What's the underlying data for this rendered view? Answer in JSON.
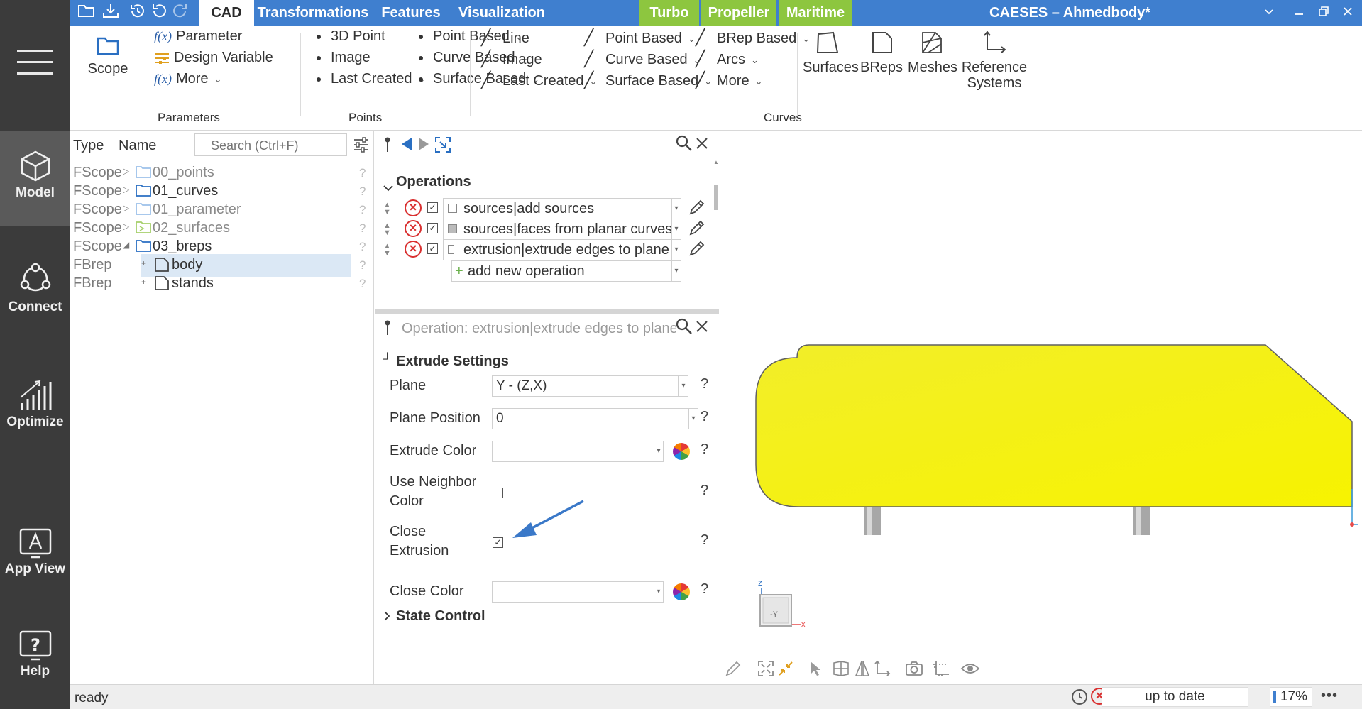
{
  "sidebar": {
    "items": [
      {
        "label": "Model"
      },
      {
        "label": "Connect"
      },
      {
        "label": "Optimize"
      },
      {
        "label": "App View"
      },
      {
        "label": "Help"
      }
    ]
  },
  "titlebar": {
    "tabs": [
      "CAD",
      "Transformations",
      "Features",
      "Visualization",
      "Turbo",
      "Propeller",
      "Maritime"
    ],
    "app_title": "CAESES – Ahmedbody*",
    "accent_color": "#3f7fcf",
    "plugin_tab_color": "#8dc63f"
  },
  "ribbon": {
    "scope_label": "Scope",
    "parameters": {
      "items": [
        "Parameter",
        "Design Variable",
        "More"
      ],
      "fx": "f(x)",
      "group_label": "Parameters"
    },
    "points": {
      "col1": [
        "3D Point",
        "Image",
        "Last Created"
      ],
      "col2": [
        "Point Based",
        "Curve Based",
        "Surface Based"
      ],
      "group_label": "Points"
    },
    "curves": {
      "col1": [
        "Line",
        "Image",
        "Last Created"
      ],
      "col2": [
        "Point Based",
        "Curve Based",
        "Surface Based"
      ],
      "col3": [
        "BRep Based",
        "Arcs",
        "More"
      ],
      "group_label": "Curves"
    },
    "big_buttons": [
      "Surfaces",
      "BReps",
      "Meshes",
      "Reference",
      "Systems"
    ]
  },
  "tree": {
    "col_type": "Type",
    "col_name": "Name",
    "search_placeholder": "Search (Ctrl+F)",
    "rows": [
      {
        "type": "FScope",
        "name": "00_points",
        "q": "?"
      },
      {
        "type": "FScope",
        "name": "01_curves",
        "q": "?"
      },
      {
        "type": "FScope",
        "name": "01_parameter",
        "q": "?"
      },
      {
        "type": "FScope",
        "name": "02_surfaces",
        "q": "?"
      },
      {
        "type": "FScope",
        "name": "03_breps",
        "q": "?"
      },
      {
        "type": "FBrep",
        "name": "body",
        "q": "?"
      },
      {
        "type": "FBrep",
        "name": "stands",
        "q": "?"
      }
    ]
  },
  "operations": {
    "title": "Operations",
    "rows": [
      {
        "label": "sources|add sources"
      },
      {
        "label": "sources|faces from planar curves"
      },
      {
        "label": "extrusion|extrude edges to plane"
      }
    ],
    "add_label": "add new operation"
  },
  "properties": {
    "title": "Operation: extrusion|extrude edges to plane",
    "section1": "Extrude Settings",
    "plane_label": "Plane",
    "plane_value": "Y - (Z,X)",
    "plane_position_label": "Plane Position",
    "plane_position_value": "0",
    "extrude_color_label": "Extrude Color",
    "use_neighbor_label_1": "Use Neighbor",
    "use_neighbor_label_2": "Color",
    "close_extrusion_label_1": "Close",
    "close_extrusion_label_2": "Extrusion",
    "close_extrusion_checked": true,
    "close_color_label": "Close Color",
    "section2": "State Control",
    "help_mark": "?"
  },
  "viewport": {
    "axis_z": "z",
    "axis_x": "x",
    "cube_label": "-Y",
    "body_color": "#f5f500"
  },
  "status": {
    "text": "ready",
    "update_state": "up to date",
    "zoom": "17%",
    "more": "•••"
  }
}
